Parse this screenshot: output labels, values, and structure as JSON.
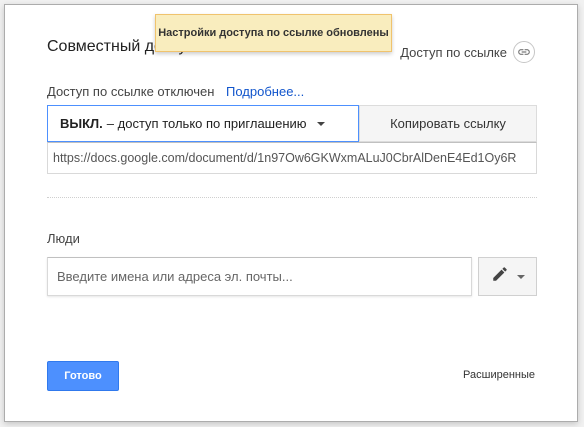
{
  "dialog": {
    "title": "Совместный доступ",
    "link_settings_label": "Доступ по ссылке",
    "link_icon": "link-icon"
  },
  "toast": {
    "message": "Настройки доступа по ссылке обновлены"
  },
  "link_access": {
    "status_text": "Доступ по ссылке отключен",
    "more_link": "Подробнее...",
    "dropdown_strong": "ВЫКЛ.",
    "dropdown_text": "– доступ только по приглашению",
    "copy_button": "Копировать ссылку",
    "url": "https://docs.google.com/document/d/1n97Ow6GKWxmALuJ0CbrAlDenE4Ed1Oy6R"
  },
  "people": {
    "label": "Люди",
    "placeholder": "Введите имена или адреса эл. почты...",
    "edit_icon": "pencil-icon"
  },
  "footer": {
    "done_button": "Готово",
    "advanced_link": "Расширенные"
  },
  "colors": {
    "accent": "#4d90fe",
    "link": "#1155cc",
    "toast_bg": "#f9edbe"
  }
}
